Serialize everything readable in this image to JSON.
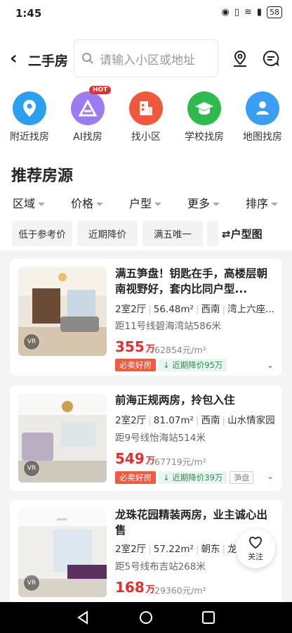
{
  "status": {
    "time": "1:45",
    "battery": "58"
  },
  "header": {
    "title": "二手房",
    "search_placeholder": "请输入小区或地址"
  },
  "quick": [
    {
      "label": "附近找房",
      "color": "#2aa0ee",
      "icon": "location-pin-icon"
    },
    {
      "label": "AI找房",
      "color": "#9a7bf0",
      "icon": "ai-house-icon",
      "badge": "HOT"
    },
    {
      "label": "找小区",
      "color": "#f0573d",
      "icon": "building-icon"
    },
    {
      "label": "学校找房",
      "color": "#2fba4e",
      "icon": "graduation-cap-icon"
    },
    {
      "label": "地图找房",
      "color": "#3a9ff2",
      "icon": "map-person-icon"
    }
  ],
  "section_title": "推荐房源",
  "filters": [
    "区域",
    "价格",
    "户型",
    "更多",
    "排序"
  ],
  "tags": [
    "低于参考价",
    "近期降价",
    "满五唯一"
  ],
  "layout_tag": "户型图",
  "listings": [
    {
      "title": "满五笋盘！钥匙在手，高楼层朝南视野好，套内比同户型...",
      "rooms": "2室2厅",
      "area": "56.48m²",
      "orient": "西南",
      "community": "湾上六座...",
      "metro": "距11号线碧海湾站586米",
      "price": "355",
      "price_unit": "万",
      "unit_price": "62854元/m²",
      "badge1": "必卖好房",
      "badge2": "近期降价95万",
      "badge3": ""
    },
    {
      "title": "前海正规两房，拎包入住",
      "rooms": "2室2厅",
      "area": "81.07m²",
      "orient": "西南",
      "community": "山水情家园",
      "metro": "距9号线怡海站514米",
      "price": "549",
      "price_unit": "万",
      "unit_price": "67719元/m²",
      "badge1": "必卖好房",
      "badge2": "近期降价39万",
      "badge3": "笋盘"
    },
    {
      "title": "龙珠花园精装两房，业主诚心出售",
      "rooms": "2室2厅",
      "area": "57.22m²",
      "orient": "朝东",
      "community": "龙珠",
      "metro": "距5号线布吉站268米",
      "price": "168",
      "price_unit": "万",
      "unit_price": "29360元/m²",
      "badge1": "",
      "badge2": "",
      "badge3": ""
    }
  ],
  "vr_label": "VR",
  "follow_label": "关注"
}
